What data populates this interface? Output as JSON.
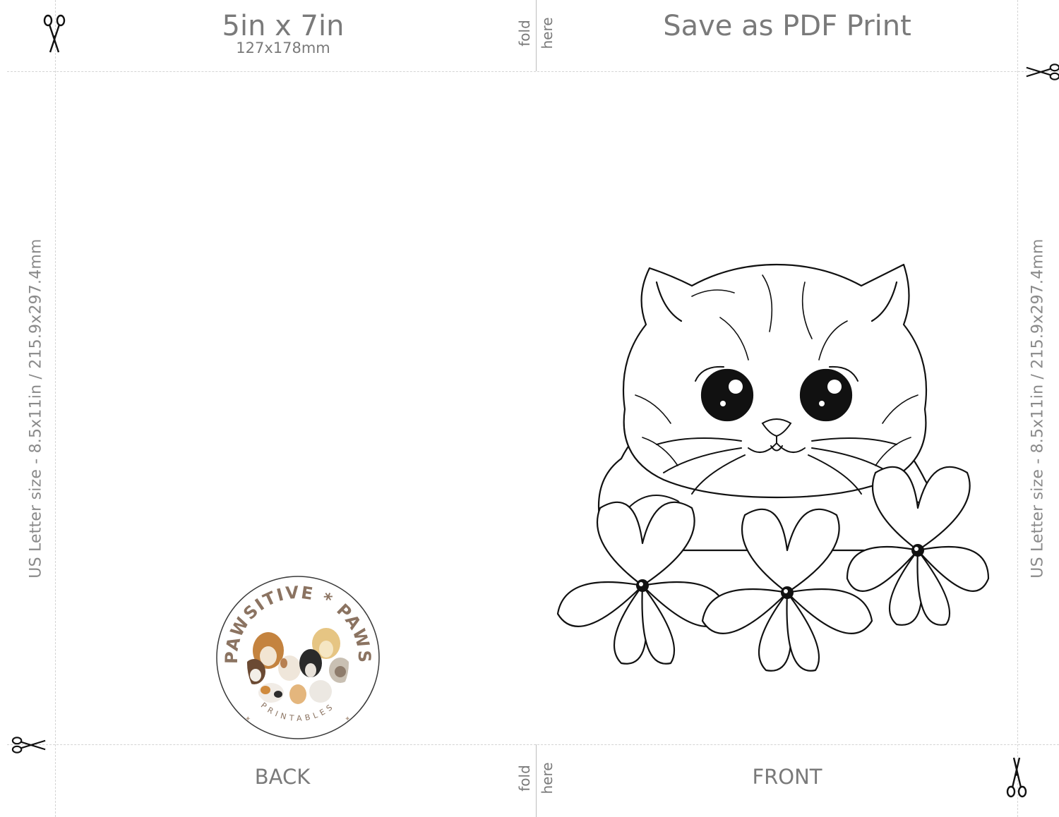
{
  "header": {
    "size_title": "5in x 7in",
    "size_sub": "127x178mm",
    "save_label": "Save as PDF Print",
    "fold_word": "fold",
    "here_word": "here"
  },
  "side": {
    "left_text": "US Letter size - 8.5x11in / 215.9x297.4mm",
    "right_text": "US Letter size - 8.5x11in / 215.9x297.4mm"
  },
  "footer": {
    "back_label": "BACK",
    "front_label": "FRONT",
    "fold_word": "fold",
    "here_word": "here"
  },
  "logo": {
    "arc_text": "PAWSITIVE * PAWS",
    "bottom_text": "PRINTABLES",
    "colors": {
      "brown": "#8b7361",
      "ring": "#3a3a3a"
    }
  },
  "illustration": {
    "subject": "kitten-with-flowers",
    "line_color": "#111111"
  },
  "icons": [
    "scissors-icon"
  ]
}
